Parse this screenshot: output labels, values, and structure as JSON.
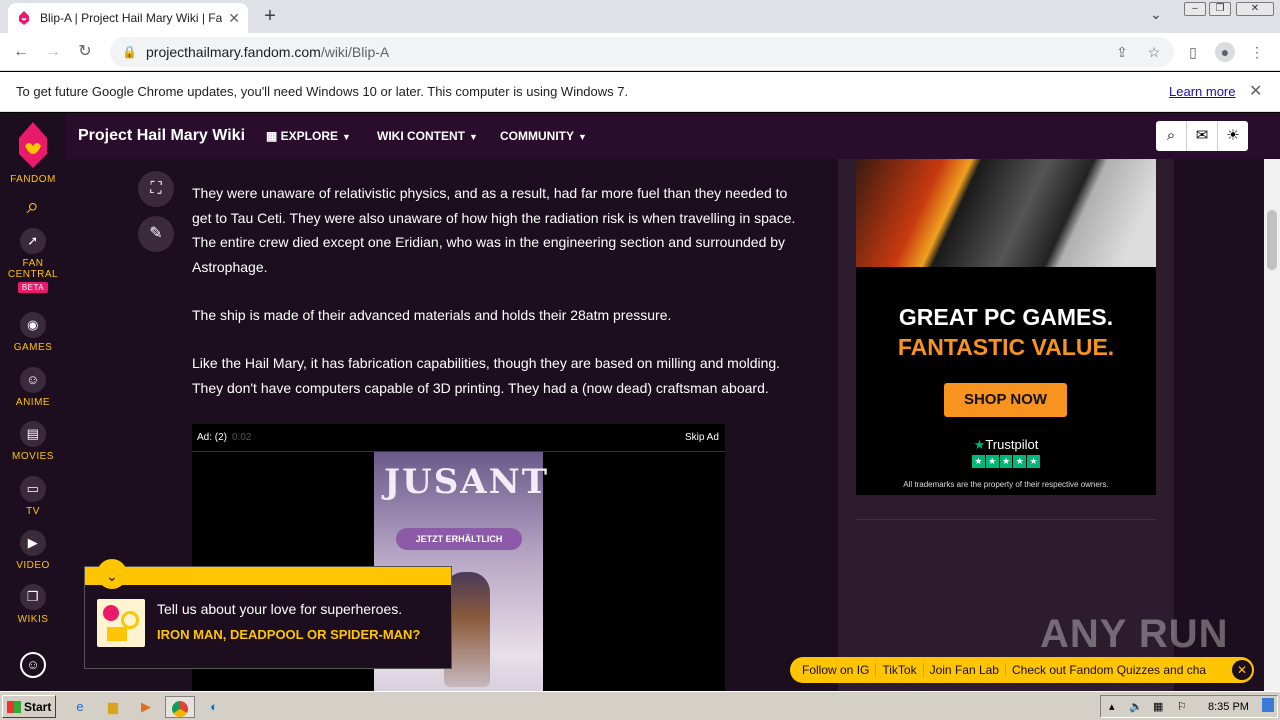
{
  "browser": {
    "tab_title": "Blip-A | Project Hail Mary Wiki | Fandom",
    "tab_close": "✕",
    "new_tab": "+",
    "url_host": "projecthailmary.fandom.com",
    "url_path": "/wiki/Blip-A"
  },
  "infobar": {
    "message": "To get future Google Chrome updates, you'll need Windows 10 or later. This computer is using Windows 7.",
    "learn_more": "Learn more"
  },
  "rail": {
    "fandom": "FANDOM",
    "fan_central_1": "FAN",
    "fan_central_2": "CENTRAL",
    "beta": "BETA",
    "games": "GAMES",
    "anime": "ANIME",
    "movies": "MOVIES",
    "tv": "TV",
    "video": "VIDEO",
    "wikis": "WIKIS"
  },
  "nav": {
    "wiki_name": "Project Hail Mary Wiki",
    "explore": "EXPLORE",
    "wiki_content": "WIKI CONTENT",
    "community": "COMMUNITY"
  },
  "article": {
    "p1": "They were unaware of relativistic physics, and as a result, had far more fuel than they needed to get to Tau Ceti. They were also unaware of how high the radiation risk is when travelling in space. The entire crew died except one Eridian, who was in the engineering section and surrounded by Astrophage.",
    "p2": "The ship is made of their advanced materials and holds their 28atm pressure.",
    "p3": "Like the Hail Mary, it has fabrication capabilities, though they are based on milling and molding. They don't have computers capable of 3D printing. They had a (now dead) craftsman aboard."
  },
  "video_ad": {
    "ad_label": "Ad: (2)",
    "ad_timer": "0:02",
    "skip": "Skip Ad",
    "title": "JUSANT",
    "badge": "JETZT ERHÄLTLICH"
  },
  "side_ad": {
    "line1": "GREAT PC GAMES.",
    "line2": "FANTASTIC VALUE.",
    "cta": "SHOP NOW",
    "trustpilot": "Trustpilot",
    "trademark": "All trademarks are the property of their respective owners."
  },
  "popup": {
    "text": "Tell us about your love for superheroes.",
    "question": "IRON MAN, DEADPOOL OR SPIDER-MAN?"
  },
  "sticky": {
    "links": [
      "Follow on IG",
      "TikTok",
      "Join Fan Lab",
      "Check out Fandom Quizzes and cha"
    ]
  },
  "watermark": "ANY RUN",
  "taskbar": {
    "start": "Start",
    "time": "8:35 PM"
  },
  "colors": {
    "fandom_yellow": "#ffc500",
    "fandom_pink": "#ea1a6b",
    "page_bg": "#1c0e1e",
    "ad_orange": "#f7931e"
  }
}
